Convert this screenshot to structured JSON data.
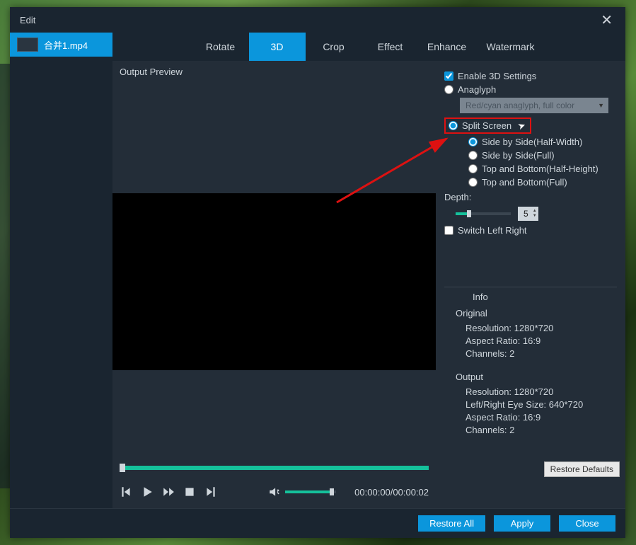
{
  "window": {
    "title": "Edit"
  },
  "file_tab": {
    "label": "合并1.mp4"
  },
  "tabs": {
    "rotate": "Rotate",
    "threeD": "3D",
    "crop": "Crop",
    "effect": "Effect",
    "enhance": "Enhance",
    "watermark": "Watermark",
    "active": "3D"
  },
  "preview": {
    "label": "Output Preview",
    "time": "00:00:00/00:00:02"
  },
  "settings": {
    "enable_3d": {
      "label": "Enable 3D Settings",
      "checked": true
    },
    "anaglyph": {
      "label": "Anaglyph",
      "selected": false,
      "dropdown": "Red/cyan anaglyph, full color"
    },
    "split_screen": {
      "label": "Split Screen",
      "selected": true
    },
    "split_options": {
      "sbs_half": {
        "label": "Side by Side(Half-Width)",
        "selected": true
      },
      "sbs_full": {
        "label": "Side by Side(Full)",
        "selected": false
      },
      "tb_half": {
        "label": "Top and Bottom(Half-Height)",
        "selected": false
      },
      "tb_full": {
        "label": "Top and Bottom(Full)",
        "selected": false
      }
    },
    "depth": {
      "label": "Depth:",
      "value": "5"
    },
    "switch_lr": {
      "label": "Switch Left Right",
      "checked": false
    }
  },
  "info": {
    "header": "Info",
    "original": {
      "head": "Original",
      "resolution": "Resolution: 1280*720",
      "aspect": "Aspect Ratio: 16:9",
      "channels": "Channels: 2"
    },
    "output": {
      "head": "Output",
      "resolution": "Resolution: 1280*720",
      "eye_size": "Left/Right Eye Size: 640*720",
      "aspect": "Aspect Ratio: 16:9",
      "channels": "Channels: 2"
    }
  },
  "buttons": {
    "restore_defaults": "Restore Defaults",
    "restore_all": "Restore All",
    "apply": "Apply",
    "close": "Close"
  }
}
